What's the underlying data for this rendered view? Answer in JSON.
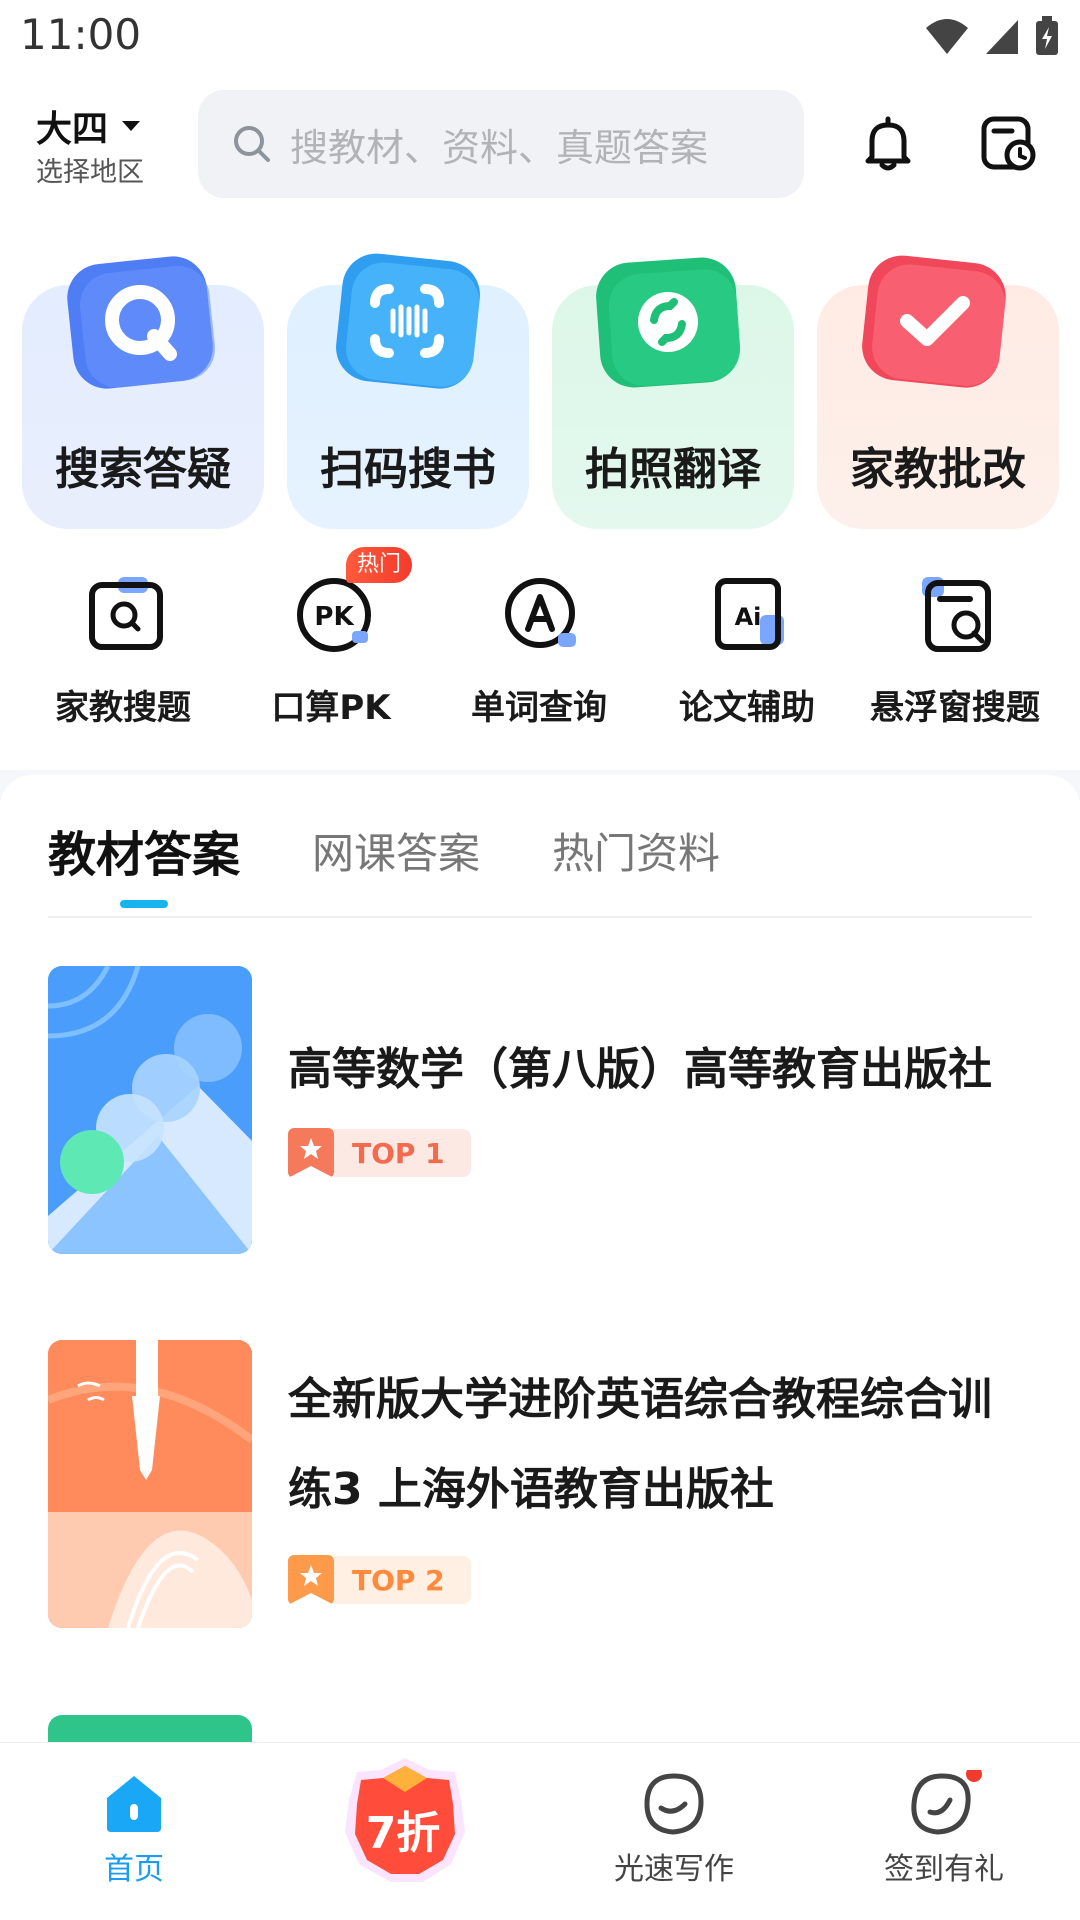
{
  "status_bar": {
    "time": "11:00"
  },
  "header": {
    "grade": "大四",
    "region": "选择地区",
    "search_placeholder": "搜教材、资料、真题答案"
  },
  "feature_cards": [
    {
      "label": "搜索答疑",
      "icon": "search-icon"
    },
    {
      "label": "扫码搜书",
      "icon": "scan-icon"
    },
    {
      "label": "拍照翻译",
      "icon": "translate-icon"
    },
    {
      "label": "家教批改",
      "icon": "check-icon"
    }
  ],
  "tools": [
    {
      "label": "家教搜题",
      "icon": "search-question-icon"
    },
    {
      "label": "口算PK",
      "icon": "pk-icon",
      "badge": "热门"
    },
    {
      "label": "单词查询",
      "icon": "word-lookup-icon"
    },
    {
      "label": "论文辅助",
      "icon": "ai-icon"
    },
    {
      "label": "悬浮窗搜题",
      "icon": "floating-window-icon"
    }
  ],
  "tabs": [
    {
      "label": "教材答案",
      "active": true
    },
    {
      "label": "网课答案",
      "active": false
    },
    {
      "label": "热门资料",
      "active": false
    }
  ],
  "books": [
    {
      "title": "高等数学（第八版）高等教育出版社",
      "rank": "TOP 1"
    },
    {
      "title": "全新版大学进阶英语综合教程综合训练3 上海外语教育出版社",
      "rank": "TOP 2"
    }
  ],
  "bottom_nav": [
    {
      "label": "首页",
      "active": true,
      "icon": "home-icon"
    },
    {
      "label": "7折",
      "active": false,
      "icon": "discount-icon"
    },
    {
      "label": "光速写作",
      "active": false,
      "icon": "writing-icon"
    },
    {
      "label": "签到有礼",
      "active": false,
      "icon": "checkin-icon"
    }
  ],
  "colors": {
    "accent": "#16b3ee",
    "nav_active": "#1a9cf2",
    "rank_orange": "#f26b4f",
    "hot_red": "#f23b2c"
  }
}
